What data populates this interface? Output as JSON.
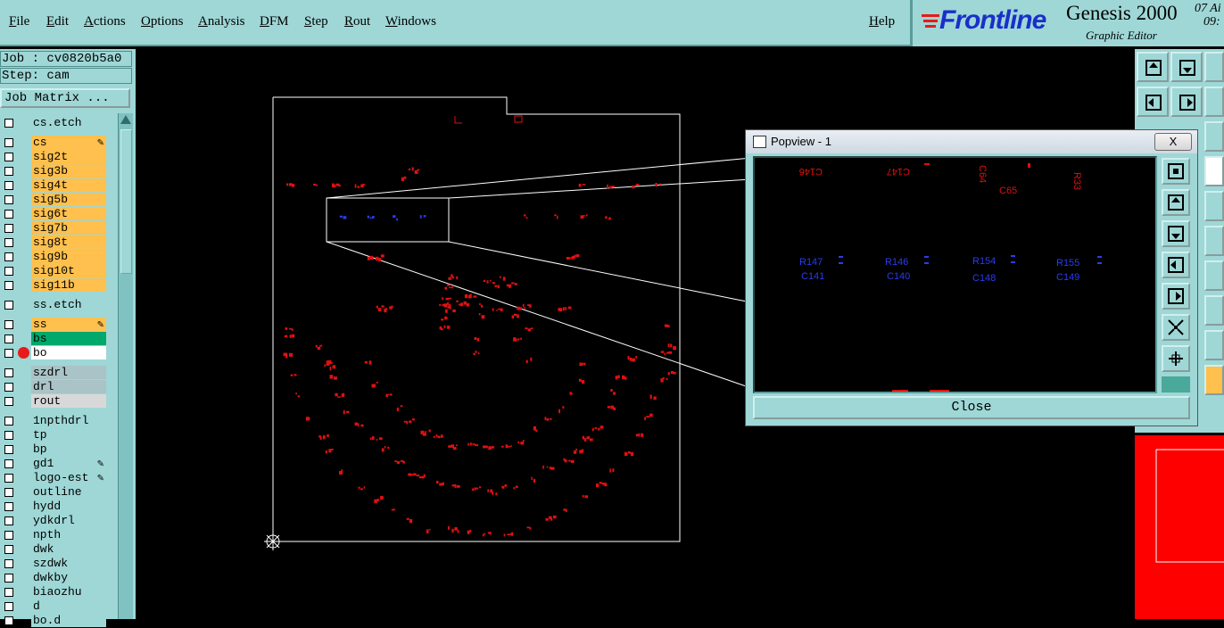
{
  "menu": {
    "items": [
      "File",
      "Edit",
      "Actions",
      "Options",
      "Analysis",
      "DFM",
      "Step",
      "Rout",
      "Windows"
    ],
    "help": "Help"
  },
  "brand": {
    "logo": "Frontline",
    "product": "Genesis 2000",
    "subtitle": "Graphic Editor",
    "date_line1": "07 Ai",
    "date_line2": "09:"
  },
  "job": {
    "job_label": "Job : cv0820b5a0",
    "step_label": "Step: cam",
    "job_matrix_button": "Job Matrix ..."
  },
  "layers": [
    {
      "name": "cs.etch",
      "color": "#9ed7d6",
      "dot": false,
      "edit": false,
      "group_gap": false
    },
    {
      "name": "cs",
      "color": "#ffc04d",
      "dot": false,
      "edit": true,
      "group_gap": true
    },
    {
      "name": "sig2t",
      "color": "#ffc04d",
      "dot": false,
      "edit": false
    },
    {
      "name": "sig3b",
      "color": "#ffc04d",
      "dot": false,
      "edit": false
    },
    {
      "name": "sig4t",
      "color": "#ffc04d",
      "dot": false,
      "edit": false
    },
    {
      "name": "sig5b",
      "color": "#ffc04d",
      "dot": false,
      "edit": false
    },
    {
      "name": "sig6t",
      "color": "#ffc04d",
      "dot": false,
      "edit": false
    },
    {
      "name": "sig7b",
      "color": "#ffc04d",
      "dot": false,
      "edit": false
    },
    {
      "name": "sig8t",
      "color": "#ffc04d",
      "dot": false,
      "edit": false
    },
    {
      "name": "sig9b",
      "color": "#ffc04d",
      "dot": false,
      "edit": false
    },
    {
      "name": "sig10t",
      "color": "#ffc04d",
      "dot": false,
      "edit": false
    },
    {
      "name": "sig11b",
      "color": "#ffc04d",
      "dot": false,
      "edit": false
    },
    {
      "name": "ss.etch",
      "color": "#9ed7d6",
      "dot": false,
      "edit": false,
      "group_gap": true
    },
    {
      "name": "ss",
      "color": "#ffc04d",
      "dot": false,
      "edit": true,
      "group_gap": true
    },
    {
      "name": "bs",
      "color": "#00a86b",
      "dot": false,
      "edit": false
    },
    {
      "name": "bo",
      "color": "#ffffff",
      "dot": true,
      "edit": false
    },
    {
      "name": "szdrl",
      "color": "#a9c3c6",
      "dot": false,
      "edit": false,
      "group_gap": true
    },
    {
      "name": "drl",
      "color": "#a9c3c6",
      "dot": false,
      "edit": false
    },
    {
      "name": "rout",
      "color": "#d8d8d8",
      "dot": false,
      "edit": false
    },
    {
      "name": "1npthdrl",
      "color": "#9ed7d6",
      "dot": false,
      "edit": false,
      "group_gap": true
    },
    {
      "name": "tp",
      "color": "#9ed7d6",
      "dot": false,
      "edit": false
    },
    {
      "name": "bp",
      "color": "#9ed7d6",
      "dot": false,
      "edit": false
    },
    {
      "name": "gd1",
      "color": "#9ed7d6",
      "dot": false,
      "edit": true
    },
    {
      "name": "logo-est",
      "color": "#9ed7d6",
      "dot": false,
      "edit": true
    },
    {
      "name": "outline",
      "color": "#9ed7d6",
      "dot": false,
      "edit": false
    },
    {
      "name": "hydd",
      "color": "#9ed7d6",
      "dot": false,
      "edit": false
    },
    {
      "name": "ydkdrl",
      "color": "#9ed7d6",
      "dot": false,
      "edit": false
    },
    {
      "name": "npth",
      "color": "#9ed7d6",
      "dot": false,
      "edit": false
    },
    {
      "name": "dwk",
      "color": "#9ed7d6",
      "dot": false,
      "edit": false
    },
    {
      "name": "szdwk",
      "color": "#9ed7d6",
      "dot": false,
      "edit": false
    },
    {
      "name": "dwkby",
      "color": "#9ed7d6",
      "dot": false,
      "edit": false
    },
    {
      "name": "biaozhu",
      "color": "#9ed7d6",
      "dot": false,
      "edit": false
    },
    {
      "name": "d",
      "color": "#9ed7d6",
      "dot": false,
      "edit": false
    },
    {
      "name": "bo.d",
      "color": "#9ed7d6",
      "dot": false,
      "edit": false
    }
  ],
  "popview": {
    "title": "Popview - 1",
    "close_x": "X",
    "close_button": "Close",
    "blue_labels": [
      "R147",
      "C141",
      "R146",
      "C140",
      "R154",
      "C148",
      "R155",
      "C149"
    ],
    "red_labels": [
      "C146",
      "C147",
      "C64",
      "C65",
      "R33"
    ]
  },
  "colors": {
    "panel": "#9ed7d6",
    "board_red": "#e11010",
    "board_blue": "#2a3cf0",
    "outline": "#ffffff"
  }
}
